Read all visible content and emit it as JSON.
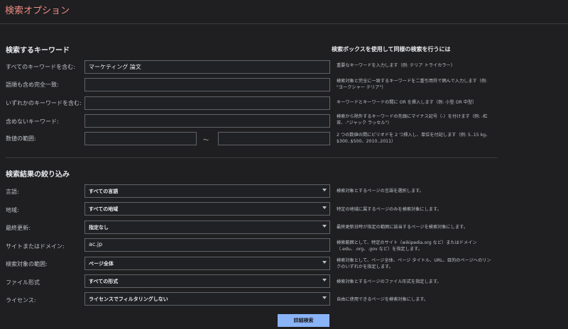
{
  "header": {
    "title": "検索オプション"
  },
  "keywords": {
    "section_title": "検索するキーワード",
    "help_title": "検索ボックスを使用して同様の検索を行うには",
    "rows": [
      {
        "label": "すべてのキーワードを含む:",
        "value": "マーケティング 論文",
        "hint": "重要なキーワードを入力します（例: テリア トライカラー）"
      },
      {
        "label": "語順も含め完全一致:",
        "value": "",
        "hint": "検索対象と完全に一致するキーワードを二重引用符で囲んで入力します（例: \"ヨークシャー テリア\"）"
      },
      {
        "label": "いずれかのキーワードを含む:",
        "value": "",
        "hint": "キーワードとキーワードの間に OR を挿入します（例: 小型 OR 中型）"
      },
      {
        "label": "含めないキーワード:",
        "value": "",
        "hint": "検索から除外するキーワードの先頭にマイナス記号（-）を付けます（例: -紅茶、-\"ジャック ラッセル\"）"
      },
      {
        "label": "数値の範囲:",
        "value": "",
        "hint": "2 つの数値の間にピリオドを 2 つ挿入し、単位を付記します（例: 5..15 kg、$300..$500、2010..2011）"
      }
    ],
    "range_sep": "～",
    "range_to_value": ""
  },
  "filters": {
    "section_title": "検索結果の絞り込み",
    "rows": [
      {
        "label": "言語:",
        "value": "すべての言語",
        "hint": "検索対象とするページの言語を選択します。"
      },
      {
        "label": "地域:",
        "value": "すべての地域",
        "hint": "特定の地域に属するページのみを検索対象にします。"
      },
      {
        "label": "最終更新:",
        "value": "指定なし",
        "hint": "最終更新日時が指定の範囲に該当するページを検索対象にします。"
      },
      {
        "label": "サイトまたはドメイン:",
        "value": "ac.jp",
        "hint": "検索範囲として、特定のサイト（wikipedia.org など）またはドメイン（.edu、.org、.gov など）を指定します。"
      },
      {
        "label": "検索対象の範囲:",
        "value": "ページ全体",
        "hint": "検索対象として、ページ全体、ページ タイトル、URL、目的のページへのリンクのいずれかを指定します。"
      },
      {
        "label": "ファイル形式",
        "value": "すべての形式",
        "hint": "検索対象とするページのファイル形式を指定します。"
      },
      {
        "label": "ライセンス:",
        "value": "ライセンスでフィルタリングしない",
        "hint": "自由に使用できるページを検索対象にします。"
      }
    ]
  },
  "submit_label": "詳細検索"
}
